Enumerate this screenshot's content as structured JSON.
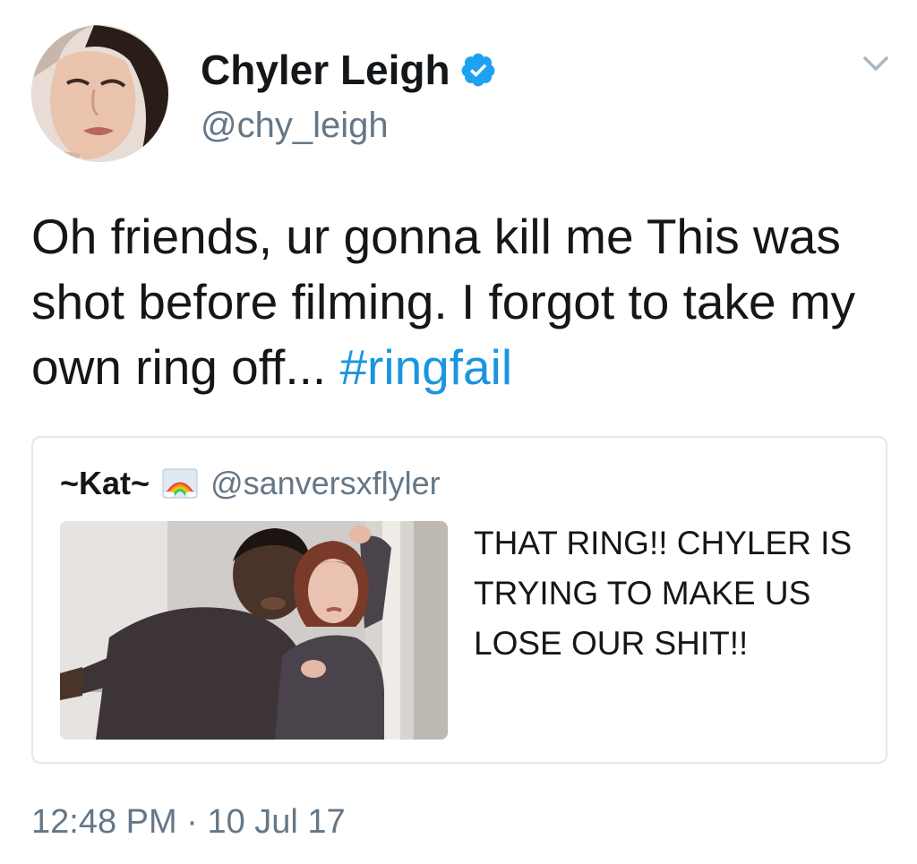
{
  "author": {
    "display_name": "Chyler Leigh",
    "handle": "@chy_leigh",
    "verified": true,
    "avatar_icon": "profile-photo"
  },
  "tweet": {
    "text": "Oh friends, ur gonna kill me This was shot before filming. I forgot to take my own ring off...",
    "hashtag": "#ringfail",
    "timestamp_time": "12:48 PM",
    "timestamp_separator": "·",
    "timestamp_date": "10 Jul 17"
  },
  "quoted_tweet": {
    "display_name": "~Kat~",
    "name_emoji": "rainbow-icon",
    "handle": "@sanversxflyler",
    "text": "THAT RING!! CHYLER IS TRYING TO MAKE US LOSE OUR SHIT!!"
  },
  "colors": {
    "link": "#1b95e0",
    "secondary_text": "#657786",
    "primary_text": "#14171a",
    "border": "#e1e8ed",
    "verified_badge": "#1da1f2"
  }
}
